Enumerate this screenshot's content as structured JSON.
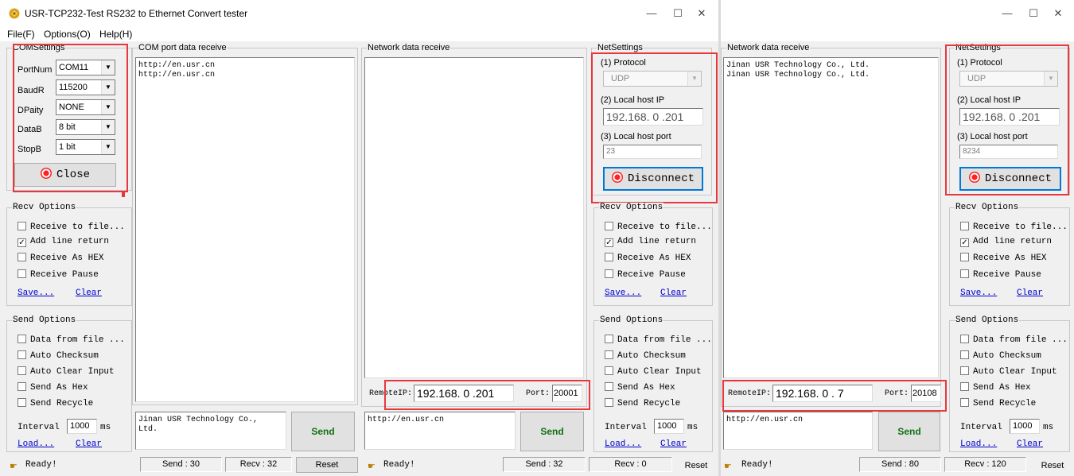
{
  "window1": {
    "title": "USR-TCP232-Test  RS232 to Ethernet Convert tester",
    "menu": [
      "File(F)",
      "Options(O)",
      "Help(H)"
    ],
    "window_controls": {
      "minimize": "—",
      "maximize": "☐",
      "close": "✕"
    },
    "com_settings": {
      "group_label": "COMSettings",
      "port_label": "PortNum",
      "port_value": "COM11",
      "baud_label": "BaudR",
      "baud_value": "115200",
      "parity_label": "DPaity",
      "parity_value": "NONE",
      "databits_label": "DataB",
      "databits_value": "8 bit",
      "stopbits_label": "StopB",
      "stopbits_value": "1 bit",
      "close_button": "Close"
    },
    "com_receive": {
      "group_label": "COM port data receive",
      "text": "http://en.usr.cn\nhttp://en.usr.cn"
    },
    "recv_options": {
      "group_label": "Recv Options",
      "items": [
        {
          "label": "Receive to file...",
          "checked": false
        },
        {
          "label": "Add line return",
          "checked": true
        },
        {
          "label": "Receive As HEX",
          "checked": false
        },
        {
          "label": "Receive Pause",
          "checked": false
        }
      ],
      "save_link": "Save...",
      "clear_link": "Clear"
    },
    "send_options": {
      "group_label": "Send Options",
      "items": [
        {
          "label": "Data from file ...",
          "checked": false
        },
        {
          "label": "Auto Checksum",
          "checked": false
        },
        {
          "label": "Auto Clear Input",
          "checked": false
        },
        {
          "label": "Send As Hex",
          "checked": false
        },
        {
          "label": "Send Recycle",
          "checked": false
        }
      ],
      "interval_label": "Interval",
      "interval_value": "1000",
      "interval_unit": "ms",
      "load_link": "Load...",
      "clear_link": "Clear"
    },
    "com_send_text": "Jinan USR Technology Co.,\nLtd.",
    "com_send_button": "Send",
    "status": {
      "ready": "Ready!",
      "send": "Send : 30",
      "recv": "Recv : 32",
      "reset": "Reset"
    }
  },
  "window1_net": {
    "receive_label": "Network data receive",
    "receive_text": "",
    "remote_ip_label": "RemoteIP:",
    "remote_ip_value": "192.168. 0 .201",
    "port_label": "Port:",
    "port_value": "20001",
    "send_text": "http://en.usr.cn",
    "send_button": "Send",
    "status": {
      "ready": "Ready!",
      "send": "Send : 32",
      "recv": "Recv : 0",
      "reset": "Reset"
    },
    "net_settings": {
      "group_label": "NetSettings",
      "protocol_label": "(1) Protocol",
      "protocol_value": "UDP",
      "local_ip_label": "(2) Local host IP",
      "local_ip_value": "192.168. 0 .201",
      "local_port_label": "(3) Local host port",
      "local_port_value": "23",
      "disconnect_button": "Disconnect"
    },
    "recv_options": {
      "group_label": "Recv Options",
      "items": [
        {
          "label": "Receive to file...",
          "checked": false
        },
        {
          "label": "Add line return",
          "checked": true
        },
        {
          "label": "Receive As HEX",
          "checked": false
        },
        {
          "label": "Receive Pause",
          "checked": false
        }
      ],
      "save_link": "Save...",
      "clear_link": "Clear"
    },
    "send_options": {
      "group_label": "Send Options",
      "items": [
        {
          "label": "Data from file ...",
          "checked": false
        },
        {
          "label": "Auto Checksum",
          "checked": false
        },
        {
          "label": "Auto Clear Input",
          "checked": false
        },
        {
          "label": "Send As Hex",
          "checked": false
        },
        {
          "label": "Send Recycle",
          "checked": false
        }
      ],
      "interval_label": "Interval",
      "interval_value": "1000",
      "interval_unit": "ms",
      "load_link": "Load...",
      "clear_link": "Clear"
    }
  },
  "window2": {
    "window_controls": {
      "minimize": "—",
      "maximize": "☐",
      "close": "✕"
    },
    "receive_label": "Network data receive",
    "receive_text": "Jinan USR Technology Co., Ltd.\nJinan USR Technology Co., Ltd.",
    "remote_ip_label": "RemoteIP:",
    "remote_ip_value": "192.168. 0 . 7",
    "port_label": "Port:",
    "port_value": "20108",
    "send_text": "http://en.usr.cn",
    "send_button": "Send",
    "status": {
      "ready": "Ready!",
      "send": "Send : 80",
      "recv": "Recv : 120",
      "reset": "Reset"
    },
    "net_settings": {
      "group_label": "NetSettings",
      "protocol_label": "(1) Protocol",
      "protocol_value": "UDP",
      "local_ip_label": "(2) Local host IP",
      "local_ip_value": "192.168. 0 .201",
      "local_port_label": "(3) Local host port",
      "local_port_value": "8234",
      "disconnect_button": "Disconnect"
    },
    "recv_options": {
      "group_label": "Recv Options",
      "items": [
        {
          "label": "Receive to file...",
          "checked": false
        },
        {
          "label": "Add line return",
          "checked": true
        },
        {
          "label": "Receive As HEX",
          "checked": false
        },
        {
          "label": "Receive Pause",
          "checked": false
        }
      ],
      "save_link": "Save...",
      "clear_link": "Clear"
    },
    "send_options": {
      "group_label": "Send Options",
      "items": [
        {
          "label": "Data from file ...",
          "checked": false
        },
        {
          "label": "Auto Checksum",
          "checked": false
        },
        {
          "label": "Auto Clear Input",
          "checked": false
        },
        {
          "label": "Send As Hex",
          "checked": false
        },
        {
          "label": "Send Recycle",
          "checked": false
        }
      ],
      "interval_label": "Interval",
      "interval_value": "1000",
      "interval_unit": "ms",
      "load_link": "Load...",
      "clear_link": "Clear"
    }
  },
  "colors": {
    "highlight": "#e8383d",
    "link": "#0000cc",
    "window_bg": "#f0f0f0"
  },
  "icons": {
    "app": "usr-app-icon",
    "status": "hand-pointer-icon",
    "led": "red-led-icon"
  }
}
